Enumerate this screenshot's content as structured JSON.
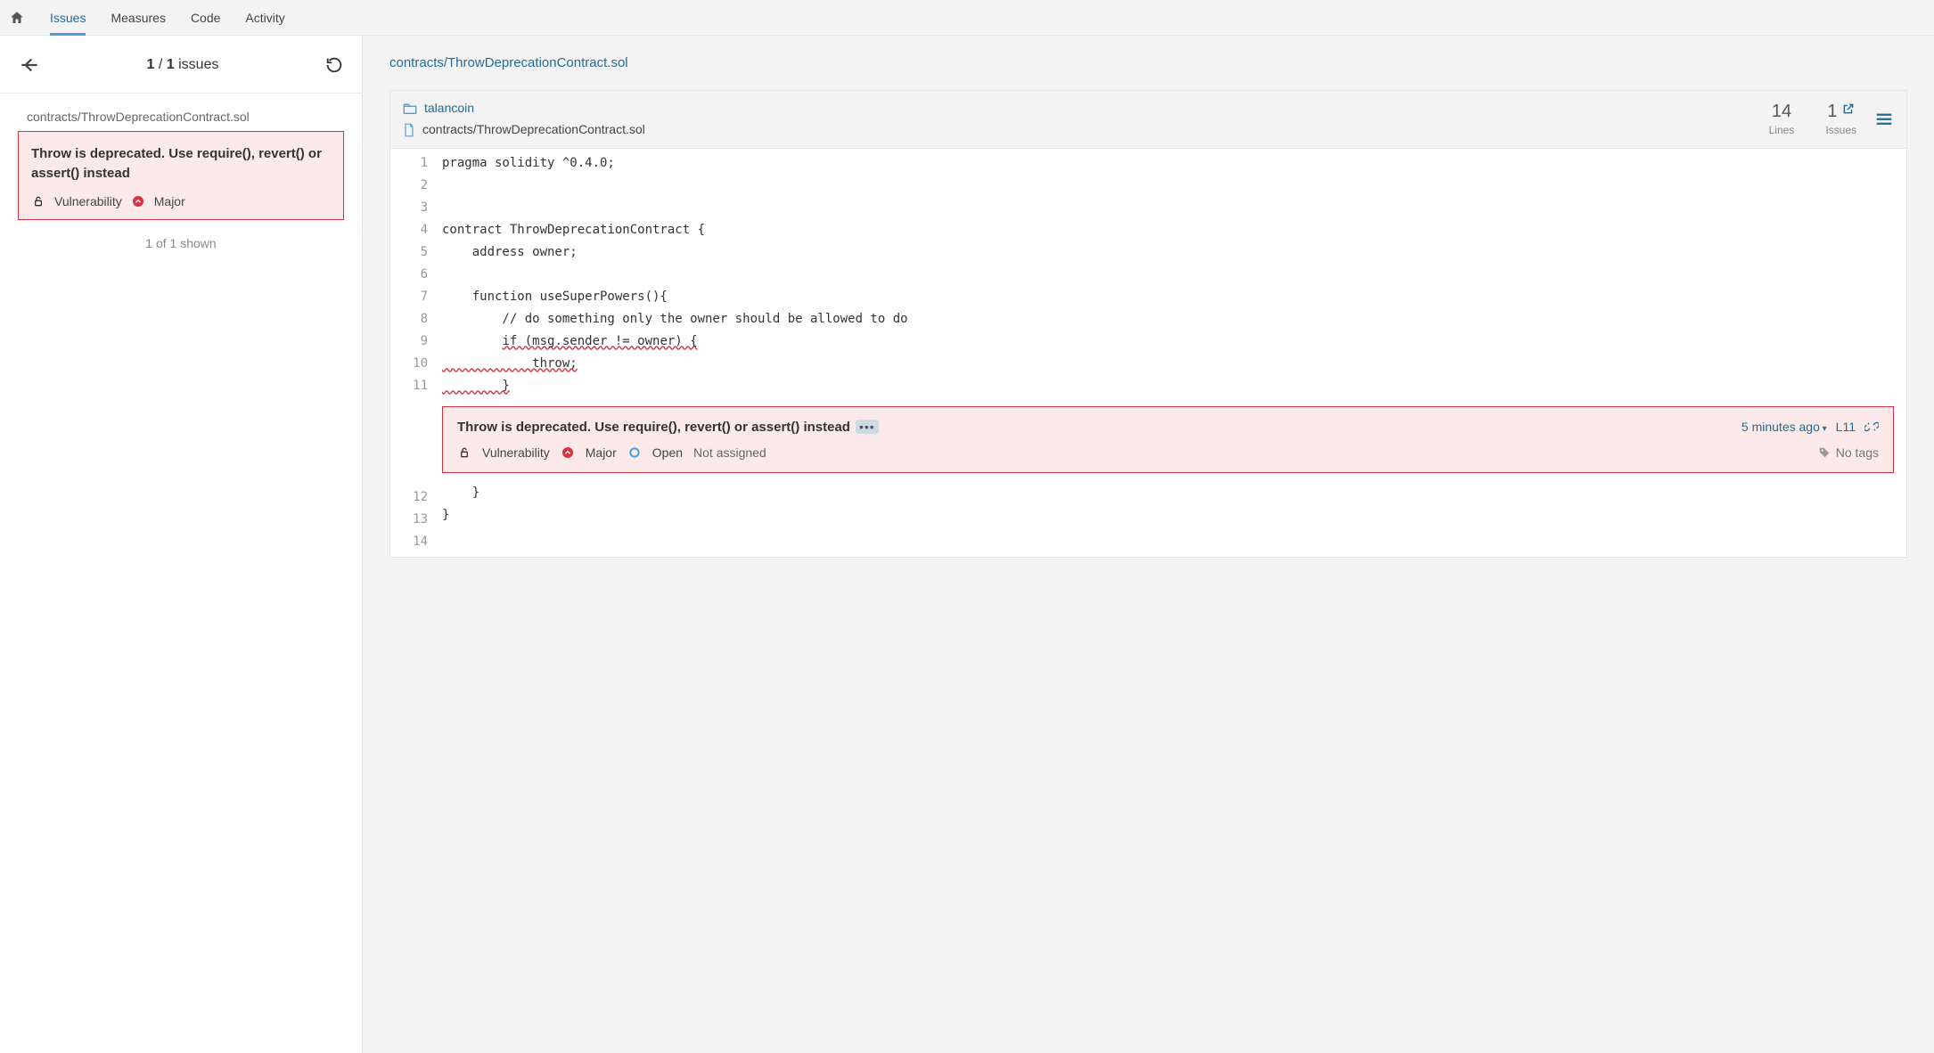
{
  "nav": {
    "tabs": [
      "Issues",
      "Measures",
      "Code",
      "Activity"
    ],
    "active": "Issues"
  },
  "sidebar": {
    "counter_current": "1",
    "counter_total": "1",
    "counter_suffix": "issues",
    "file_path": "contracts/ThrowDeprecationContract.sol",
    "issue": {
      "title": "Throw is deprecated. Use require(), revert() or assert() instead",
      "type": "Vulnerability",
      "severity": "Major"
    },
    "shown": "1 of 1 shown"
  },
  "main": {
    "breadcrumb": "contracts/ThrowDeprecationContract.sol",
    "project": "talancoin",
    "file_path": "contracts/ThrowDeprecationContract.sol",
    "stats": {
      "lines_value": "14",
      "lines_label": "Lines",
      "issues_value": "1",
      "issues_label": "Issues"
    },
    "code_lines": [
      "pragma solidity ^0.4.0;",
      "",
      "",
      "contract ThrowDeprecationContract {",
      "    address owner;",
      "",
      "    function useSuperPowers(){",
      "        // do something only the owner should be allowed to do",
      "        if (msg.sender != owner) {",
      "            throw;",
      "        }",
      "    }",
      "}",
      ""
    ],
    "inline_issue": {
      "title": "Throw is deprecated. Use require(), revert() or assert() instead",
      "age": "5 minutes ago",
      "line_ref": "L11",
      "type": "Vulnerability",
      "severity": "Major",
      "status": "Open",
      "assignee": "Not assigned",
      "tags": "No tags"
    }
  }
}
